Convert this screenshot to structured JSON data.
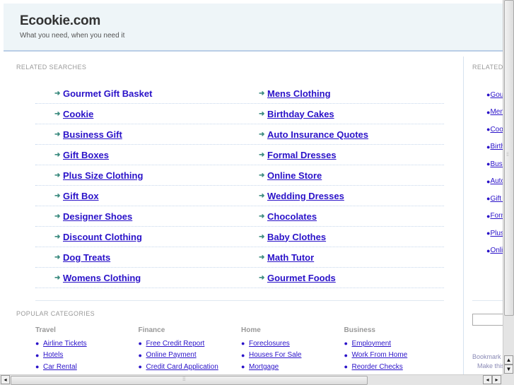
{
  "header": {
    "title": "Ecookie.com",
    "tagline": "What you need, when you need it"
  },
  "related": {
    "title": "RELATED SEARCHES",
    "rows": [
      [
        "Gourmet Gift Basket",
        "Mens Clothing"
      ],
      [
        "Cookie",
        "Birthday Cakes"
      ],
      [
        "Business Gift",
        "Auto Insurance Quotes"
      ],
      [
        "Gift Boxes",
        "Formal Dresses"
      ],
      [
        "Plus Size Clothing",
        "Online Store"
      ],
      [
        "Gift Box",
        "Wedding Dresses"
      ],
      [
        "Designer Shoes",
        "Chocolates"
      ],
      [
        "Discount Clothing",
        "Baby Clothes"
      ],
      [
        "Dog Treats",
        "Math Tutor"
      ],
      [
        "Womens Clothing",
        "Gourmet Foods"
      ]
    ]
  },
  "popular": {
    "title": "POPULAR CATEGORIES",
    "categories": [
      {
        "name": "Travel",
        "links": [
          "Airline Tickets",
          "Hotels",
          "Car Rental"
        ]
      },
      {
        "name": "Finance",
        "links": [
          "Free Credit Report",
          "Online Payment",
          "Credit Card Application"
        ]
      },
      {
        "name": "Home",
        "links": [
          "Foreclosures",
          "Houses For Sale",
          "Mortgage"
        ]
      },
      {
        "name": "Business",
        "links": [
          "Employment",
          "Work From Home",
          "Reorder Checks"
        ]
      }
    ]
  },
  "sidebar": {
    "title": "RELATED",
    "links": [
      "Gourmet Gift Basket",
      "Mens Clothing",
      "Cookie",
      "Birthday Cakes",
      "Business Gift",
      "Auto Insurance Quotes",
      "Gift Boxes",
      "Formal Dresses",
      "Plus Size Clothing",
      "Online Store"
    ],
    "bookmark": "Bookmark",
    "make_home": "Make this"
  },
  "colors": {
    "link": "#2a12c9",
    "header_bg": "#eef5f8",
    "arrow": "#3c8b7f"
  }
}
